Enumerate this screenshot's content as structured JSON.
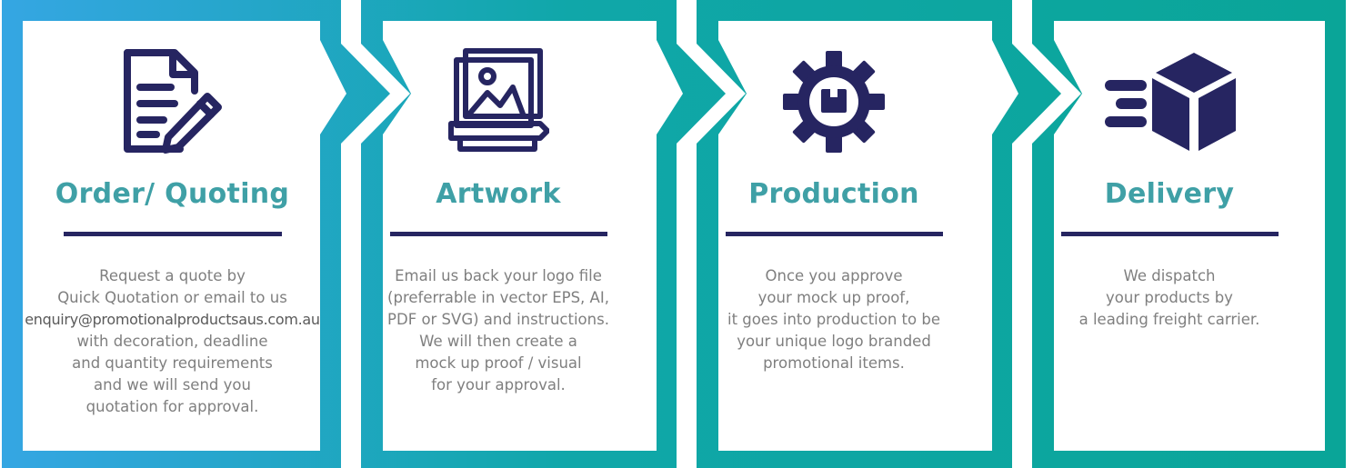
{
  "colors": {
    "title": "#3fa0a6",
    "rule": "#262561",
    "icon": "#262561",
    "body_text": "#7f7f7f",
    "frame_gradient_start": "#35a6e3",
    "frame_gradient_end": "#0aa598"
  },
  "steps": [
    {
      "icon": "document-pencil-icon",
      "title": "Order/ Quoting",
      "lines": [
        "Request a quote by",
        "Quick Quotation or email to us",
        "enquiry@promotionalproductsaus.com.au",
        "with decoration, deadline",
        "and quantity requirements",
        "and we will send you",
        "quotation for approval."
      ]
    },
    {
      "icon": "artwork-image-icon",
      "title": "Artwork",
      "lines": [
        "Email us back your logo file",
        "(preferrable in vector EPS, AI,",
        "PDF or SVG) and instructions.",
        "We will then create a",
        "mock up proof / visual",
        "for your approval."
      ]
    },
    {
      "icon": "gear-box-icon",
      "title": "Production",
      "lines": [
        "Once you approve",
        "your mock up proof,",
        "it goes into production to be",
        "your unique logo branded",
        "promotional items."
      ]
    },
    {
      "icon": "delivery-box-icon",
      "title": "Delivery",
      "lines": [
        "We dispatch",
        "your products by",
        "a leading freight carrier."
      ]
    }
  ]
}
